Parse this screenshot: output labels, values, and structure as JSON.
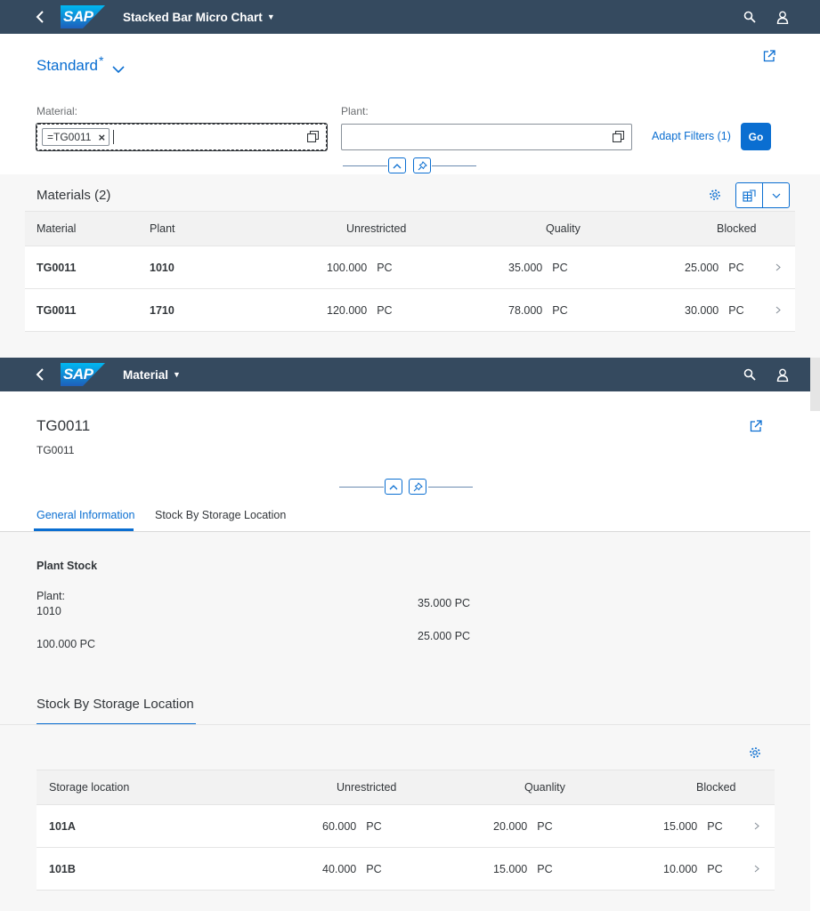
{
  "shell1": {
    "logo": "SAP",
    "title": "Stacked Bar Micro Chart"
  },
  "filterbar": {
    "variant": "Standard",
    "variant_modified": "*",
    "material_label": "Material:",
    "material_token": "=TG0011",
    "plant_label": "Plant:",
    "plant_value": "",
    "adapt_filters": "Adapt Filters (1)",
    "go": "Go"
  },
  "materials_table": {
    "title": "Materials (2)",
    "columns": [
      "Material",
      "Plant",
      "Unrestricted",
      "Quality",
      "Blocked"
    ],
    "rows": [
      {
        "material": "TG0011",
        "plant": "1010",
        "unrestricted": "100.000",
        "quality": "35.000",
        "blocked": "25.000",
        "unit": "PC"
      },
      {
        "material": "TG0011",
        "plant": "1710",
        "unrestricted": "120.000",
        "quality": "78.000",
        "blocked": "30.000",
        "unit": "PC"
      }
    ]
  },
  "shell2": {
    "logo": "SAP",
    "title": "Material"
  },
  "object": {
    "title": "TG0011",
    "subtitle": "TG0011",
    "tabs": [
      "General Information",
      "Stock By Storage Location"
    ],
    "plant_stock": {
      "title": "Plant Stock",
      "plant_label": "Plant:",
      "plant_value": "1010",
      "unrestricted": "100.000 PC",
      "quality": "35.000 PC",
      "blocked": "25.000 PC"
    },
    "storage_section_title": "Stock By Storage Location",
    "storage_table": {
      "columns": [
        "Storage location",
        "Unrestricted",
        "Quanlity",
        "Blocked"
      ],
      "rows": [
        {
          "location": "101A",
          "unrestricted": "60.000",
          "quality": "20.000",
          "blocked": "15.000",
          "unit": "PC"
        },
        {
          "location": "101B",
          "unrestricted": "40.000",
          "quality": "15.000",
          "blocked": "10.000",
          "unit": "PC"
        }
      ]
    }
  },
  "colors": {
    "shell": "#354a5f",
    "accent": "#0a6ed1",
    "text": "#32363a"
  },
  "icons": [
    "back-icon",
    "search-icon",
    "user-icon",
    "share-icon",
    "value-help-icon",
    "collapse-icon",
    "pin-icon",
    "gear-icon",
    "table-export-icon",
    "chevron-down-icon",
    "nav-arrow-icon"
  ]
}
